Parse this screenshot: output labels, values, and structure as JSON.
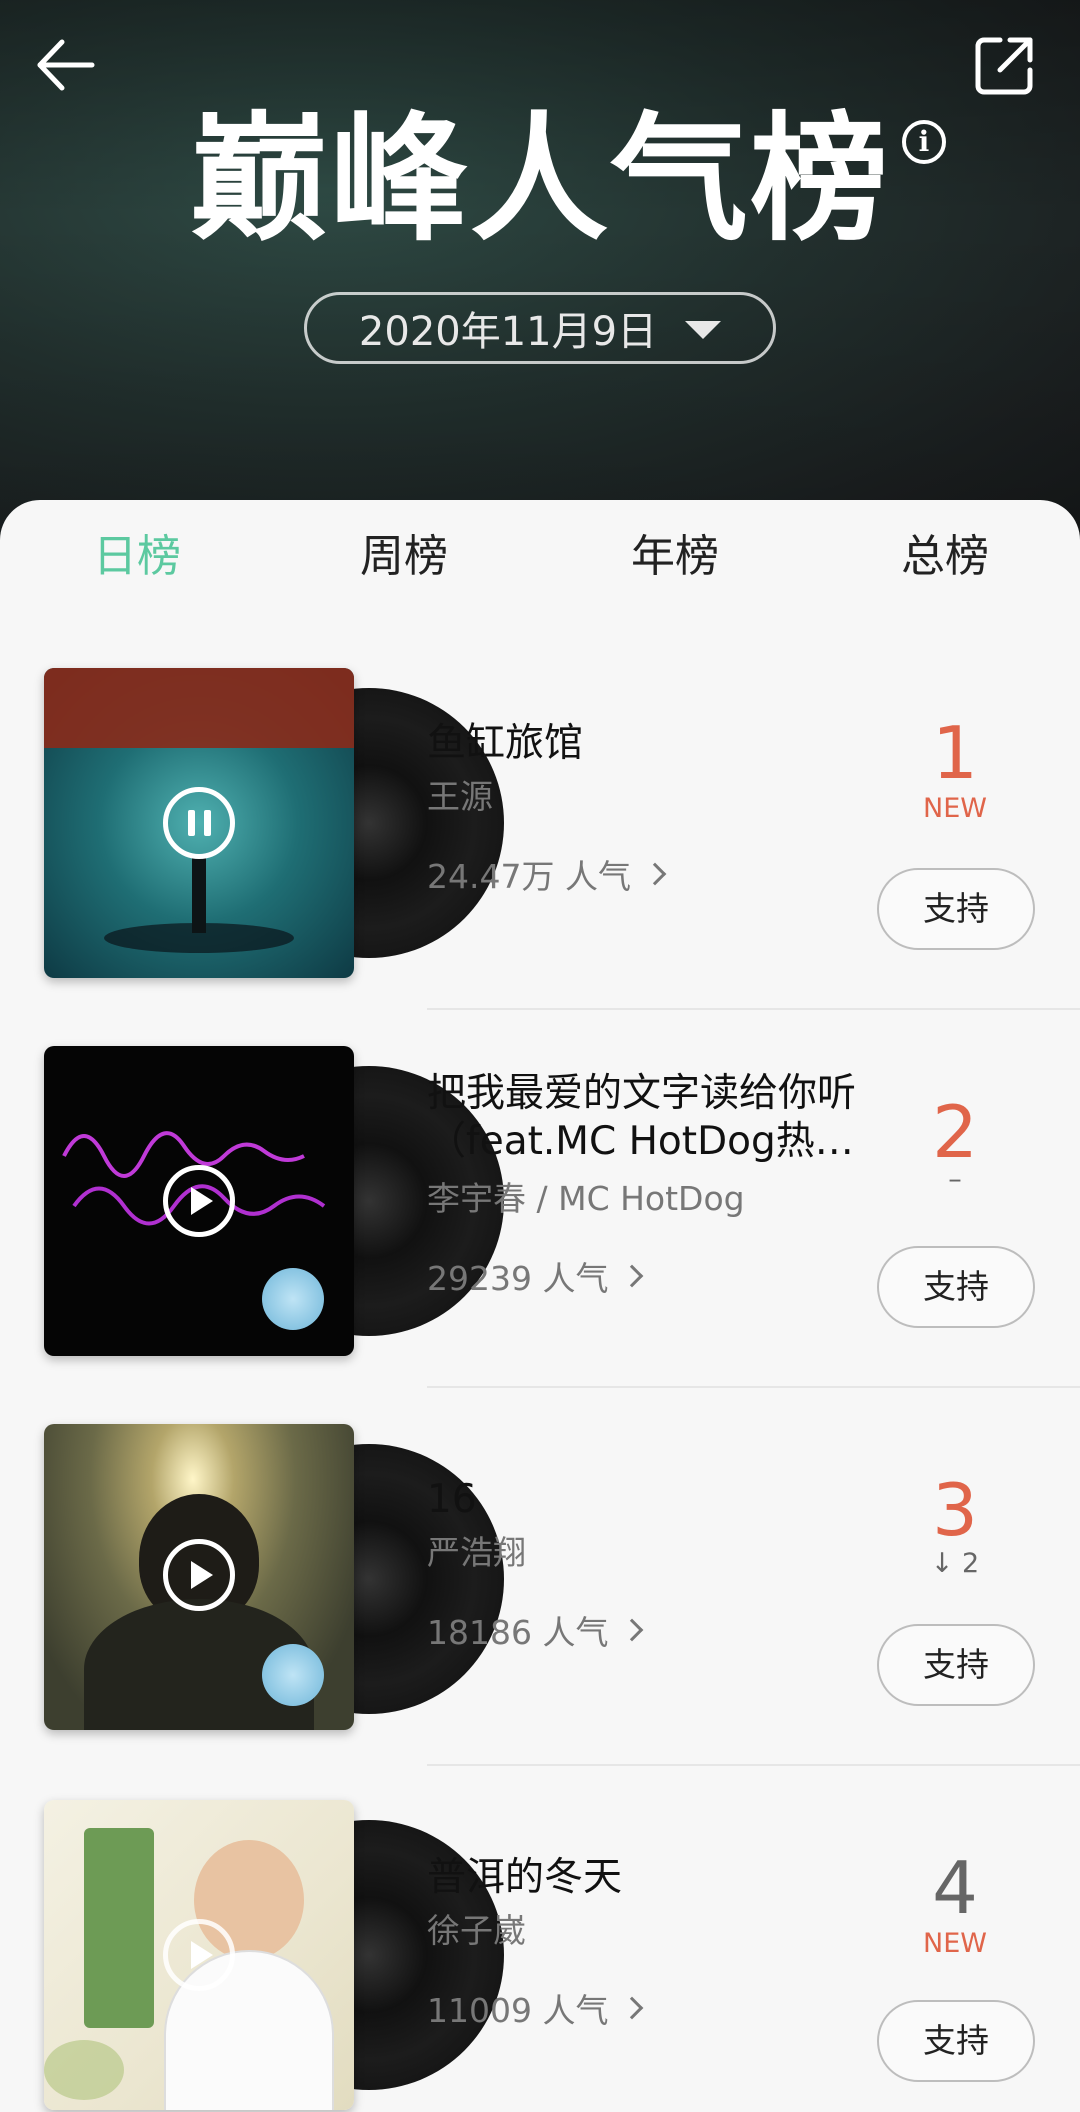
{
  "header": {
    "title": "巅峰人气榜",
    "date": "2020年11月9日",
    "info_label": "i"
  },
  "tabs": [
    {
      "label": "日榜",
      "active": true
    },
    {
      "label": "周榜",
      "active": false
    },
    {
      "label": "年榜",
      "active": false
    },
    {
      "label": "总榜",
      "active": false
    }
  ],
  "songs": [
    {
      "title": "鱼缸旅馆",
      "artist": "王源",
      "popularity": "24.47万 人气",
      "rank": "1",
      "change": "NEW",
      "support": "支持",
      "state": "playing"
    },
    {
      "title": "把我最爱的文字读给你听（feat.MC HotDog热…",
      "artist": "李宇春 / MC HotDog",
      "popularity": "29239 人气",
      "rank": "2",
      "change": "–",
      "support": "支持",
      "state": "paused"
    },
    {
      "title": "16",
      "artist": "严浩翔",
      "popularity": "18186 人气",
      "rank": "3",
      "change": "↓ 2",
      "support": "支持",
      "state": "paused"
    },
    {
      "title": "普洱的冬天",
      "artist": "徐子崴",
      "popularity": "11009 人气",
      "rank": "4",
      "change": "NEW",
      "support": "支持",
      "state": "paused"
    }
  ],
  "colors": {
    "accent": "#5cc9a0",
    "rank_top": "#e0654a",
    "rank_other": "#666666"
  }
}
